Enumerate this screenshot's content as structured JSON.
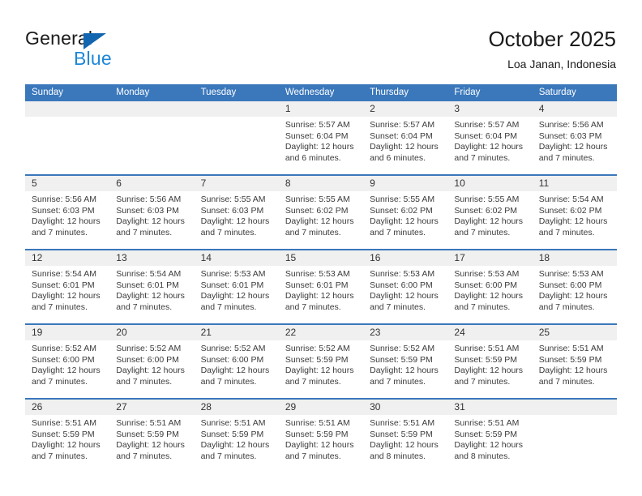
{
  "brand": {
    "name_part1": "General",
    "name_part2": "Blue",
    "triangle_icon": "blue-triangle-icon",
    "colors": {
      "dark": "#1b1b1b",
      "blue": "#1d87d6",
      "triangle": "#1266b0"
    }
  },
  "header": {
    "title": "October 2025",
    "subtitle": "Loa Janan, Indonesia"
  },
  "theme": {
    "header_bg": "#3a77bb",
    "header_text": "#ffffff",
    "daynum_band_bg": "#f0f0f0",
    "row_divider": "#3a77bb",
    "cell_bg": "#ffffff",
    "body_text": "#3b3b3b"
  },
  "weekdays": [
    "Sunday",
    "Monday",
    "Tuesday",
    "Wednesday",
    "Thursday",
    "Friday",
    "Saturday"
  ],
  "weeks": [
    [
      {
        "date": "",
        "sunrise": "",
        "sunset": "",
        "daylight": ""
      },
      {
        "date": "",
        "sunrise": "",
        "sunset": "",
        "daylight": ""
      },
      {
        "date": "",
        "sunrise": "",
        "sunset": "",
        "daylight": ""
      },
      {
        "date": "1",
        "sunrise": "Sunrise: 5:57 AM",
        "sunset": "Sunset: 6:04 PM",
        "daylight": "Daylight: 12 hours and 6 minutes."
      },
      {
        "date": "2",
        "sunrise": "Sunrise: 5:57 AM",
        "sunset": "Sunset: 6:04 PM",
        "daylight": "Daylight: 12 hours and 6 minutes."
      },
      {
        "date": "3",
        "sunrise": "Sunrise: 5:57 AM",
        "sunset": "Sunset: 6:04 PM",
        "daylight": "Daylight: 12 hours and 7 minutes."
      },
      {
        "date": "4",
        "sunrise": "Sunrise: 5:56 AM",
        "sunset": "Sunset: 6:03 PM",
        "daylight": "Daylight: 12 hours and 7 minutes."
      }
    ],
    [
      {
        "date": "5",
        "sunrise": "Sunrise: 5:56 AM",
        "sunset": "Sunset: 6:03 PM",
        "daylight": "Daylight: 12 hours and 7 minutes."
      },
      {
        "date": "6",
        "sunrise": "Sunrise: 5:56 AM",
        "sunset": "Sunset: 6:03 PM",
        "daylight": "Daylight: 12 hours and 7 minutes."
      },
      {
        "date": "7",
        "sunrise": "Sunrise: 5:55 AM",
        "sunset": "Sunset: 6:03 PM",
        "daylight": "Daylight: 12 hours and 7 minutes."
      },
      {
        "date": "8",
        "sunrise": "Sunrise: 5:55 AM",
        "sunset": "Sunset: 6:02 PM",
        "daylight": "Daylight: 12 hours and 7 minutes."
      },
      {
        "date": "9",
        "sunrise": "Sunrise: 5:55 AM",
        "sunset": "Sunset: 6:02 PM",
        "daylight": "Daylight: 12 hours and 7 minutes."
      },
      {
        "date": "10",
        "sunrise": "Sunrise: 5:55 AM",
        "sunset": "Sunset: 6:02 PM",
        "daylight": "Daylight: 12 hours and 7 minutes."
      },
      {
        "date": "11",
        "sunrise": "Sunrise: 5:54 AM",
        "sunset": "Sunset: 6:02 PM",
        "daylight": "Daylight: 12 hours and 7 minutes."
      }
    ],
    [
      {
        "date": "12",
        "sunrise": "Sunrise: 5:54 AM",
        "sunset": "Sunset: 6:01 PM",
        "daylight": "Daylight: 12 hours and 7 minutes."
      },
      {
        "date": "13",
        "sunrise": "Sunrise: 5:54 AM",
        "sunset": "Sunset: 6:01 PM",
        "daylight": "Daylight: 12 hours and 7 minutes."
      },
      {
        "date": "14",
        "sunrise": "Sunrise: 5:53 AM",
        "sunset": "Sunset: 6:01 PM",
        "daylight": "Daylight: 12 hours and 7 minutes."
      },
      {
        "date": "15",
        "sunrise": "Sunrise: 5:53 AM",
        "sunset": "Sunset: 6:01 PM",
        "daylight": "Daylight: 12 hours and 7 minutes."
      },
      {
        "date": "16",
        "sunrise": "Sunrise: 5:53 AM",
        "sunset": "Sunset: 6:00 PM",
        "daylight": "Daylight: 12 hours and 7 minutes."
      },
      {
        "date": "17",
        "sunrise": "Sunrise: 5:53 AM",
        "sunset": "Sunset: 6:00 PM",
        "daylight": "Daylight: 12 hours and 7 minutes."
      },
      {
        "date": "18",
        "sunrise": "Sunrise: 5:53 AM",
        "sunset": "Sunset: 6:00 PM",
        "daylight": "Daylight: 12 hours and 7 minutes."
      }
    ],
    [
      {
        "date": "19",
        "sunrise": "Sunrise: 5:52 AM",
        "sunset": "Sunset: 6:00 PM",
        "daylight": "Daylight: 12 hours and 7 minutes."
      },
      {
        "date": "20",
        "sunrise": "Sunrise: 5:52 AM",
        "sunset": "Sunset: 6:00 PM",
        "daylight": "Daylight: 12 hours and 7 minutes."
      },
      {
        "date": "21",
        "sunrise": "Sunrise: 5:52 AM",
        "sunset": "Sunset: 6:00 PM",
        "daylight": "Daylight: 12 hours and 7 minutes."
      },
      {
        "date": "22",
        "sunrise": "Sunrise: 5:52 AM",
        "sunset": "Sunset: 5:59 PM",
        "daylight": "Daylight: 12 hours and 7 minutes."
      },
      {
        "date": "23",
        "sunrise": "Sunrise: 5:52 AM",
        "sunset": "Sunset: 5:59 PM",
        "daylight": "Daylight: 12 hours and 7 minutes."
      },
      {
        "date": "24",
        "sunrise": "Sunrise: 5:51 AM",
        "sunset": "Sunset: 5:59 PM",
        "daylight": "Daylight: 12 hours and 7 minutes."
      },
      {
        "date": "25",
        "sunrise": "Sunrise: 5:51 AM",
        "sunset": "Sunset: 5:59 PM",
        "daylight": "Daylight: 12 hours and 7 minutes."
      }
    ],
    [
      {
        "date": "26",
        "sunrise": "Sunrise: 5:51 AM",
        "sunset": "Sunset: 5:59 PM",
        "daylight": "Daylight: 12 hours and 7 minutes."
      },
      {
        "date": "27",
        "sunrise": "Sunrise: 5:51 AM",
        "sunset": "Sunset: 5:59 PM",
        "daylight": "Daylight: 12 hours and 7 minutes."
      },
      {
        "date": "28",
        "sunrise": "Sunrise: 5:51 AM",
        "sunset": "Sunset: 5:59 PM",
        "daylight": "Daylight: 12 hours and 7 minutes."
      },
      {
        "date": "29",
        "sunrise": "Sunrise: 5:51 AM",
        "sunset": "Sunset: 5:59 PM",
        "daylight": "Daylight: 12 hours and 7 minutes."
      },
      {
        "date": "30",
        "sunrise": "Sunrise: 5:51 AM",
        "sunset": "Sunset: 5:59 PM",
        "daylight": "Daylight: 12 hours and 8 minutes."
      },
      {
        "date": "31",
        "sunrise": "Sunrise: 5:51 AM",
        "sunset": "Sunset: 5:59 PM",
        "daylight": "Daylight: 12 hours and 8 minutes."
      },
      {
        "date": "",
        "sunrise": "",
        "sunset": "",
        "daylight": ""
      }
    ]
  ]
}
